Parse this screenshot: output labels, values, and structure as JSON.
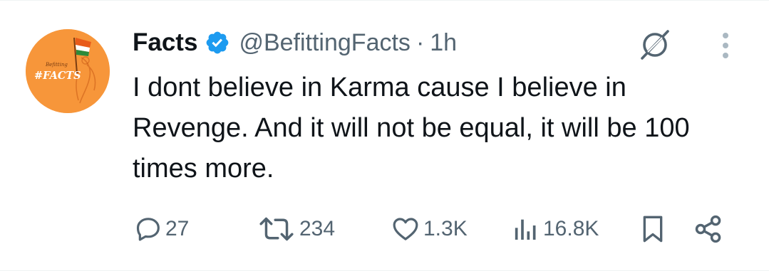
{
  "user": {
    "display_name": "Facts",
    "handle": "@BefittingFacts",
    "separator": "·",
    "time": "1h",
    "verified": true,
    "avatar": {
      "small_text": "Befitting",
      "main_text": "#FACTS",
      "background_color": "#f7963a"
    }
  },
  "tweet": {
    "text": "I dont believe in Karma cause I believe in Revenge. And it will not be equal, it will be 100 times more."
  },
  "actions": {
    "replies": "27",
    "reposts": "234",
    "likes": "1.3K",
    "views": "16.8K"
  },
  "icons": {
    "verified": "verified-badge-icon",
    "grok": "grok-icon",
    "more": "more-options-icon",
    "reply": "reply-icon",
    "repost": "repost-icon",
    "like": "heart-icon",
    "views": "views-icon",
    "bookmark": "bookmark-icon",
    "share": "share-icon"
  },
  "colors": {
    "text_primary": "#0f1419",
    "text_secondary": "#536471",
    "verified_blue": "#1d9bf0",
    "avatar_orange": "#f7963a"
  }
}
